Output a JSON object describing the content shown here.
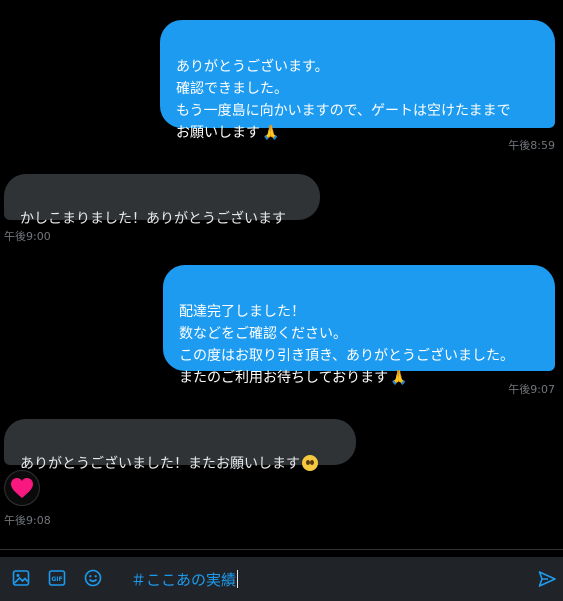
{
  "messages": [
    {
      "direction": "out",
      "text": "ありがとうございます。\n確認できました。\nもう一度島に向かいますので、ゲートは空けたままで\nお願いします",
      "emoji": "pray",
      "time": "午後8:59"
    },
    {
      "direction": "in",
      "text": "かしこまりました！ありがとうございます",
      "time": "午後9:00"
    },
    {
      "direction": "out",
      "text": "配達完了しました！\n数などをご確認ください。\nこの度はお取り引き頂き、ありがとうございました。\nまたのご利用お待ちしております",
      "emoji": "pray",
      "time": "午後9:07"
    },
    {
      "direction": "in",
      "text": "ありがとうございました！またお願いします",
      "emoji": "pleading-face",
      "reaction": "heart",
      "time": "午後9:08"
    }
  ],
  "composer": {
    "text": "＃ここあの実績",
    "icons": [
      "image-icon",
      "gif-icon",
      "emoji-icon",
      "send-icon"
    ]
  },
  "colors": {
    "accent": "#1d9bf0",
    "bubble_in": "#2f3336",
    "background": "#000000",
    "heart": "#f91880"
  }
}
